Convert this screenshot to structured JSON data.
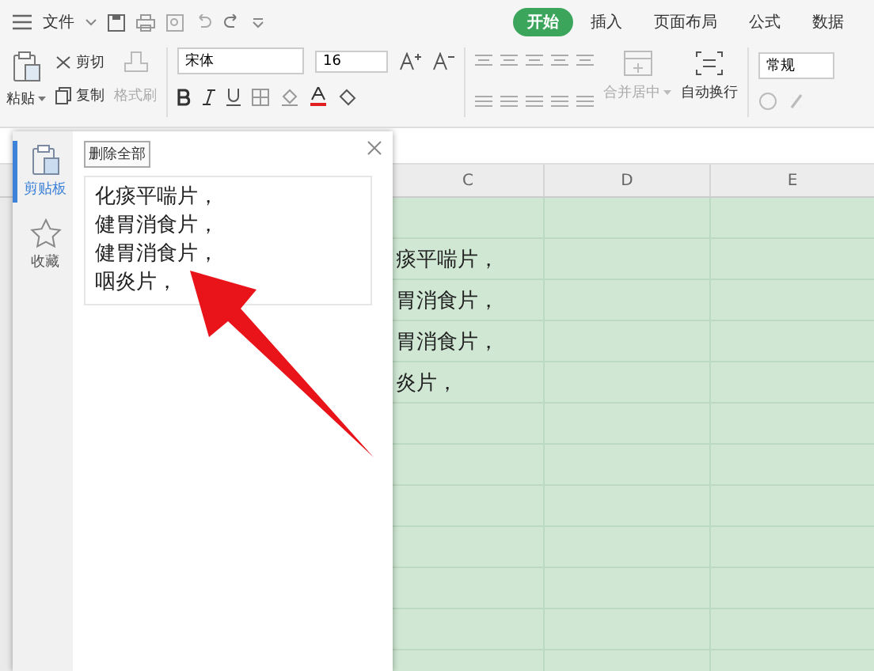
{
  "menu": {
    "label": "文件"
  },
  "tabs": [
    {
      "label": "开始",
      "selected": true
    },
    {
      "label": "插入",
      "selected": false
    },
    {
      "label": "页面布局",
      "selected": false
    },
    {
      "label": "公式",
      "selected": false
    },
    {
      "label": "数据",
      "selected": false
    }
  ],
  "ribbon": {
    "paste": "粘贴",
    "cut": {
      "label": "剪切",
      "disabled": false
    },
    "copy": {
      "label": "复制",
      "disabled": false
    },
    "format_painter": {
      "label": "格式刷",
      "disabled": true
    },
    "font": "宋体",
    "font_size": "16",
    "merge": {
      "label": "合并居中",
      "disabled": true
    },
    "wrap": {
      "label": "自动换行",
      "disabled": false
    },
    "number_format": "常规"
  },
  "clipboard_panel": {
    "nav": [
      {
        "label": "剪贴板",
        "kind": "clipboard",
        "selected": true
      },
      {
        "label": "收藏",
        "kind": "star",
        "selected": false
      }
    ],
    "clear_all": "删除全部",
    "items": [
      {
        "lines": [
          "化痰平喘片，",
          "健胃消食片，",
          "健胃消食片，",
          "咽炎片，"
        ]
      }
    ]
  },
  "sheet": {
    "columns": [
      "C",
      "D",
      "E"
    ],
    "rows": [
      "痰平喘片，",
      "胃消食片，",
      "胃消食片，",
      "炎片，"
    ]
  }
}
